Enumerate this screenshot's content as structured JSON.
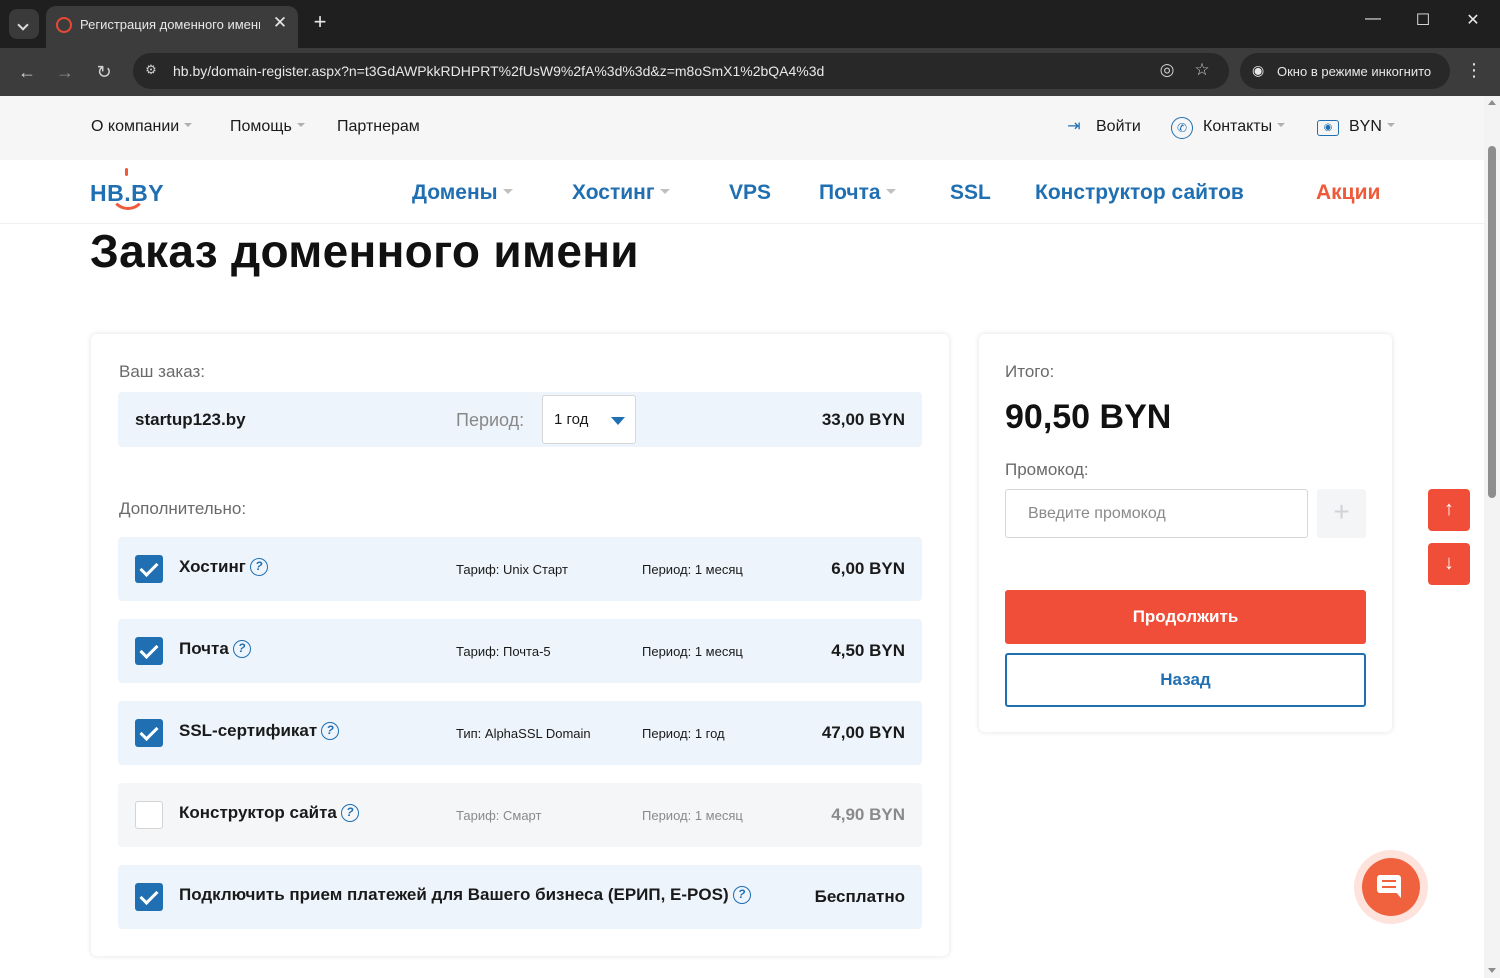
{
  "browser": {
    "tab_title": "Регистрация доменного имени",
    "tab_close": "✕",
    "new_tab": "+",
    "url": "hb.by/domain-register.aspx?n=t3GdAWPkkRDHPRT%2fUsW9%2fA%3d%3d&z=m8oSmX1%2bQA4%3d",
    "incognito_label": "Окно в режиме инкогнито",
    "window_controls": [
      "—",
      "☐",
      "✕"
    ]
  },
  "topbar": {
    "links": [
      "О компании",
      "Помощь",
      "Партнерам"
    ],
    "login": "Войти",
    "contacts": "Контакты",
    "currency": "BYN"
  },
  "header": {
    "logo": "HB.BY",
    "nav": [
      "Домены",
      "Хостинг",
      "VPS",
      "Почта",
      "SSL",
      "Конструктор сайтов",
      "Акции"
    ]
  },
  "page_title": "Заказ доменного имени",
  "order": {
    "label": "Ваш заказ:",
    "domain": "startup123.by",
    "period_label": "Период:",
    "period_value": "1 год",
    "price": "33,00 BYN",
    "extras_label": "Дополнительно:",
    "addons": [
      {
        "name": "Хостинг",
        "tariff": "Тариф: Unix Старт",
        "period": "Период: 1 месяц",
        "price": "6,00 BYN",
        "checked": true
      },
      {
        "name": "Почта",
        "tariff": "Тариф: Почта-5",
        "period": "Период: 1 месяц",
        "price": "4,50 BYN",
        "checked": true
      },
      {
        "name": "SSL-сертификат",
        "tariff": "Тип: AlphaSSL Domain",
        "period": "Период: 1 год",
        "price": "47,00 BYN",
        "checked": true
      },
      {
        "name": "Конструктор сайта",
        "tariff": "Тариф: Смарт",
        "period": "Период: 1 месяц",
        "price": "4,90 BYN",
        "checked": false
      },
      {
        "name": "Подключить прием платежей для Вашего бизнеса (ЕРИП, E-POS)",
        "price": "Бесплатно",
        "checked": true
      }
    ]
  },
  "summary": {
    "total_label": "Итого:",
    "total_value": "90,50 BYN",
    "promo_label": "Промокод:",
    "promo_placeholder": "Введите промокод",
    "continue": "Продолжить",
    "back": "Назад"
  },
  "colors": {
    "brand_blue": "#1f6fb2",
    "accent_red": "#f04e38",
    "row_bg": "#eef4fb"
  }
}
